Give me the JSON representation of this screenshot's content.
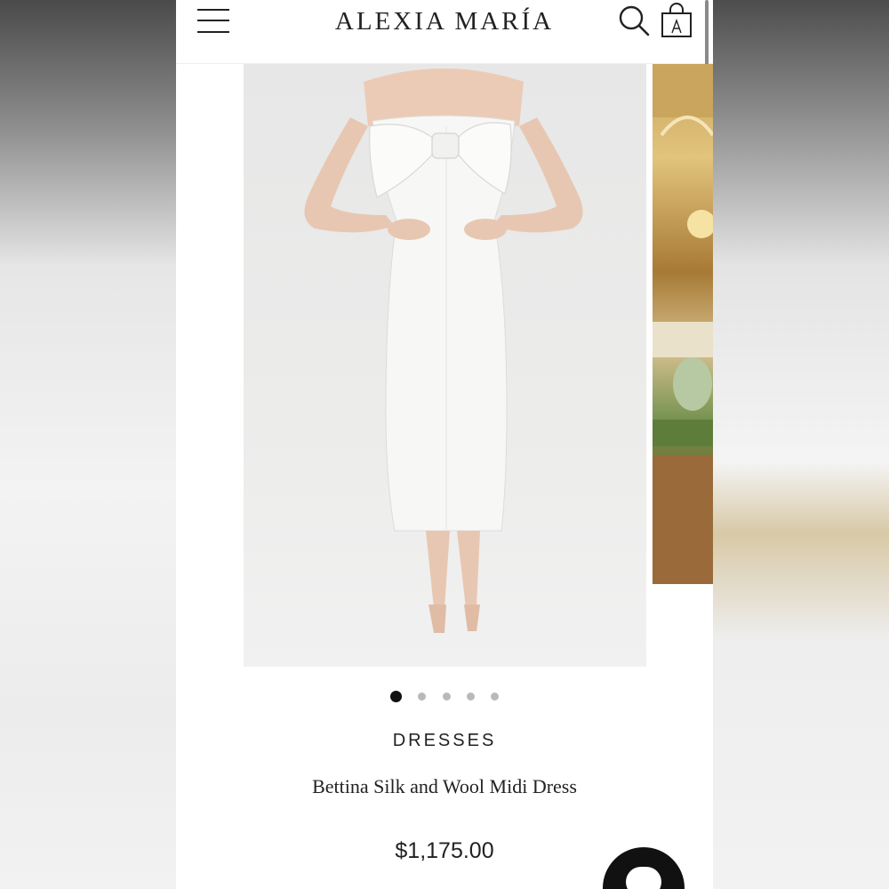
{
  "header": {
    "brand": "ALEXIA MARÍA",
    "icons": [
      "menu-icon",
      "search-icon",
      "shopping-bag-icon"
    ]
  },
  "carousel": {
    "total_slides": 5,
    "active_index": 0
  },
  "product": {
    "category": "DRESSES",
    "title": "Bettina Silk and Wool Midi Dress",
    "price": "$1,175.00"
  },
  "colors": {
    "text": "#222222",
    "dot_active": "#111111",
    "dot_inactive": "#b9b9b9",
    "chat_button": "#111111"
  }
}
